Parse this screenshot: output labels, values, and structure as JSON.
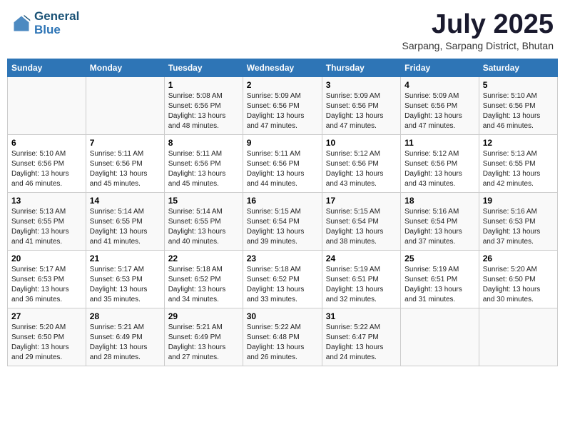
{
  "header": {
    "logo_line1": "General",
    "logo_line2": "Blue",
    "month_year": "July 2025",
    "location": "Sarpang, Sarpang District, Bhutan"
  },
  "weekdays": [
    "Sunday",
    "Monday",
    "Tuesday",
    "Wednesday",
    "Thursday",
    "Friday",
    "Saturday"
  ],
  "weeks": [
    [
      {
        "day": "",
        "sunrise": "",
        "sunset": "",
        "daylight": ""
      },
      {
        "day": "",
        "sunrise": "",
        "sunset": "",
        "daylight": ""
      },
      {
        "day": "1",
        "sunrise": "Sunrise: 5:08 AM",
        "sunset": "Sunset: 6:56 PM",
        "daylight": "Daylight: 13 hours and 48 minutes."
      },
      {
        "day": "2",
        "sunrise": "Sunrise: 5:09 AM",
        "sunset": "Sunset: 6:56 PM",
        "daylight": "Daylight: 13 hours and 47 minutes."
      },
      {
        "day": "3",
        "sunrise": "Sunrise: 5:09 AM",
        "sunset": "Sunset: 6:56 PM",
        "daylight": "Daylight: 13 hours and 47 minutes."
      },
      {
        "day": "4",
        "sunrise": "Sunrise: 5:09 AM",
        "sunset": "Sunset: 6:56 PM",
        "daylight": "Daylight: 13 hours and 47 minutes."
      },
      {
        "day": "5",
        "sunrise": "Sunrise: 5:10 AM",
        "sunset": "Sunset: 6:56 PM",
        "daylight": "Daylight: 13 hours and 46 minutes."
      }
    ],
    [
      {
        "day": "6",
        "sunrise": "Sunrise: 5:10 AM",
        "sunset": "Sunset: 6:56 PM",
        "daylight": "Daylight: 13 hours and 46 minutes."
      },
      {
        "day": "7",
        "sunrise": "Sunrise: 5:11 AM",
        "sunset": "Sunset: 6:56 PM",
        "daylight": "Daylight: 13 hours and 45 minutes."
      },
      {
        "day": "8",
        "sunrise": "Sunrise: 5:11 AM",
        "sunset": "Sunset: 6:56 PM",
        "daylight": "Daylight: 13 hours and 45 minutes."
      },
      {
        "day": "9",
        "sunrise": "Sunrise: 5:11 AM",
        "sunset": "Sunset: 6:56 PM",
        "daylight": "Daylight: 13 hours and 44 minutes."
      },
      {
        "day": "10",
        "sunrise": "Sunrise: 5:12 AM",
        "sunset": "Sunset: 6:56 PM",
        "daylight": "Daylight: 13 hours and 43 minutes."
      },
      {
        "day": "11",
        "sunrise": "Sunrise: 5:12 AM",
        "sunset": "Sunset: 6:56 PM",
        "daylight": "Daylight: 13 hours and 43 minutes."
      },
      {
        "day": "12",
        "sunrise": "Sunrise: 5:13 AM",
        "sunset": "Sunset: 6:55 PM",
        "daylight": "Daylight: 13 hours and 42 minutes."
      }
    ],
    [
      {
        "day": "13",
        "sunrise": "Sunrise: 5:13 AM",
        "sunset": "Sunset: 6:55 PM",
        "daylight": "Daylight: 13 hours and 41 minutes."
      },
      {
        "day": "14",
        "sunrise": "Sunrise: 5:14 AM",
        "sunset": "Sunset: 6:55 PM",
        "daylight": "Daylight: 13 hours and 41 minutes."
      },
      {
        "day": "15",
        "sunrise": "Sunrise: 5:14 AM",
        "sunset": "Sunset: 6:55 PM",
        "daylight": "Daylight: 13 hours and 40 minutes."
      },
      {
        "day": "16",
        "sunrise": "Sunrise: 5:15 AM",
        "sunset": "Sunset: 6:54 PM",
        "daylight": "Daylight: 13 hours and 39 minutes."
      },
      {
        "day": "17",
        "sunrise": "Sunrise: 5:15 AM",
        "sunset": "Sunset: 6:54 PM",
        "daylight": "Daylight: 13 hours and 38 minutes."
      },
      {
        "day": "18",
        "sunrise": "Sunrise: 5:16 AM",
        "sunset": "Sunset: 6:54 PM",
        "daylight": "Daylight: 13 hours and 37 minutes."
      },
      {
        "day": "19",
        "sunrise": "Sunrise: 5:16 AM",
        "sunset": "Sunset: 6:53 PM",
        "daylight": "Daylight: 13 hours and 37 minutes."
      }
    ],
    [
      {
        "day": "20",
        "sunrise": "Sunrise: 5:17 AM",
        "sunset": "Sunset: 6:53 PM",
        "daylight": "Daylight: 13 hours and 36 minutes."
      },
      {
        "day": "21",
        "sunrise": "Sunrise: 5:17 AM",
        "sunset": "Sunset: 6:53 PM",
        "daylight": "Daylight: 13 hours and 35 minutes."
      },
      {
        "day": "22",
        "sunrise": "Sunrise: 5:18 AM",
        "sunset": "Sunset: 6:52 PM",
        "daylight": "Daylight: 13 hours and 34 minutes."
      },
      {
        "day": "23",
        "sunrise": "Sunrise: 5:18 AM",
        "sunset": "Sunset: 6:52 PM",
        "daylight": "Daylight: 13 hours and 33 minutes."
      },
      {
        "day": "24",
        "sunrise": "Sunrise: 5:19 AM",
        "sunset": "Sunset: 6:51 PM",
        "daylight": "Daylight: 13 hours and 32 minutes."
      },
      {
        "day": "25",
        "sunrise": "Sunrise: 5:19 AM",
        "sunset": "Sunset: 6:51 PM",
        "daylight": "Daylight: 13 hours and 31 minutes."
      },
      {
        "day": "26",
        "sunrise": "Sunrise: 5:20 AM",
        "sunset": "Sunset: 6:50 PM",
        "daylight": "Daylight: 13 hours and 30 minutes."
      }
    ],
    [
      {
        "day": "27",
        "sunrise": "Sunrise: 5:20 AM",
        "sunset": "Sunset: 6:50 PM",
        "daylight": "Daylight: 13 hours and 29 minutes."
      },
      {
        "day": "28",
        "sunrise": "Sunrise: 5:21 AM",
        "sunset": "Sunset: 6:49 PM",
        "daylight": "Daylight: 13 hours and 28 minutes."
      },
      {
        "day": "29",
        "sunrise": "Sunrise: 5:21 AM",
        "sunset": "Sunset: 6:49 PM",
        "daylight": "Daylight: 13 hours and 27 minutes."
      },
      {
        "day": "30",
        "sunrise": "Sunrise: 5:22 AM",
        "sunset": "Sunset: 6:48 PM",
        "daylight": "Daylight: 13 hours and 26 minutes."
      },
      {
        "day": "31",
        "sunrise": "Sunrise: 5:22 AM",
        "sunset": "Sunset: 6:47 PM",
        "daylight": "Daylight: 13 hours and 24 minutes."
      },
      {
        "day": "",
        "sunrise": "",
        "sunset": "",
        "daylight": ""
      },
      {
        "day": "",
        "sunrise": "",
        "sunset": "",
        "daylight": ""
      }
    ]
  ]
}
